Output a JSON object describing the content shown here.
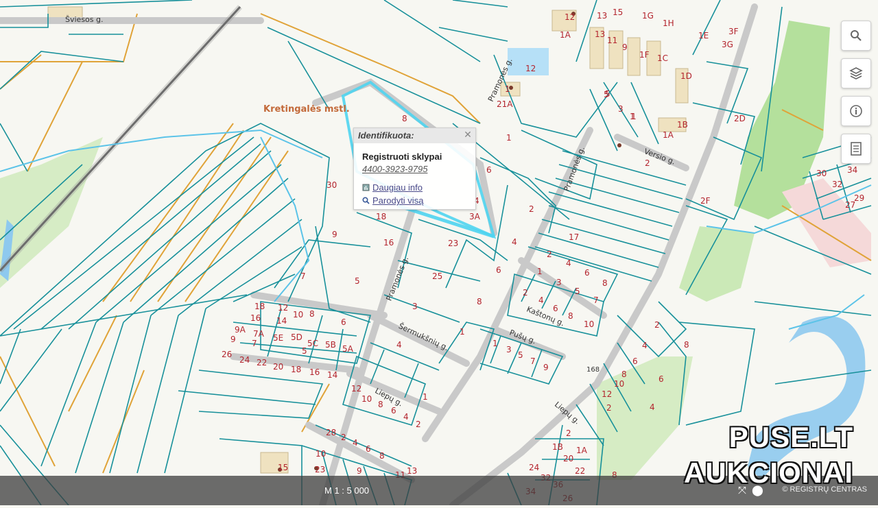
{
  "colors": {
    "parcel": "#17909a",
    "road": "#c9c9c9",
    "water": "#8ec9ee",
    "green": "#a5d98a",
    "orange": "#e0a338",
    "labels": "#b3242d",
    "highlight": "#4fd4f0"
  },
  "place_name": "Kretingalės mstl.",
  "streets": [
    "Šviesos g.",
    "Pramonės g.",
    "Pramonės g.",
    "Versio g.",
    "Pramonės g.",
    "Šermukšnių g.",
    "Kaštonų g.",
    "Pušų g.",
    "Liepų g.",
    "Liepų g."
  ],
  "road_number": "168",
  "parcel_labels": [
    "8",
    "30",
    "9",
    "18",
    "16",
    "7",
    "5",
    "23",
    "25",
    "3",
    "4",
    "3A",
    "6",
    "2",
    "4",
    "6",
    "8",
    "1",
    "17",
    "2",
    "4",
    "6",
    "8",
    "1",
    "3",
    "5",
    "7",
    "2",
    "4",
    "6",
    "8",
    "10",
    "1",
    "3",
    "5",
    "7",
    "9",
    "4",
    "2",
    "1",
    "12",
    "10",
    "8",
    "6",
    "4",
    "2",
    "1",
    "18",
    "12",
    "16",
    "14",
    "10",
    "8",
    "6",
    "9A",
    "7A",
    "5E",
    "5D",
    "5C",
    "5B",
    "5A",
    "9",
    "7",
    "5",
    "26",
    "24",
    "22",
    "20",
    "18",
    "16",
    "14",
    "12",
    "5",
    "1",
    "1A",
    "12",
    "21A",
    "1",
    "5",
    "3",
    "1",
    "1D",
    "1B",
    "1A",
    "1C",
    "1F",
    "9",
    "11",
    "13",
    "1H",
    "1G",
    "1E",
    "15",
    "13",
    "3G",
    "3F",
    "2D",
    "2F",
    "2",
    "30",
    "32",
    "34",
    "27",
    "29",
    "2",
    "4",
    "6",
    "8",
    "10",
    "12",
    "2",
    "4",
    "6",
    "8",
    "8",
    "2",
    "1A",
    "1B",
    "20",
    "22",
    "24",
    "32",
    "34",
    "36",
    "26",
    "28",
    "2",
    "4",
    "6",
    "8",
    "10",
    "9",
    "11",
    "13",
    "15",
    "23",
    "1"
  ],
  "popup": {
    "title": "Identifikuota:",
    "close_icon": "close-icon",
    "layer": "Registruoti sklypai",
    "parcel_id": "4400-3923-9795",
    "more_info": "Daugiau info",
    "show_all": "Parodyti visą"
  },
  "tools": [
    {
      "name": "search-icon",
      "symbol": "⚲"
    },
    {
      "name": "layers-icon",
      "symbol": "◈"
    },
    {
      "name": "info-icon",
      "symbol": "ⓘ"
    },
    {
      "name": "document-icon",
      "symbol": "▤"
    }
  ],
  "scale": "M 1 : 5 000",
  "watermark": {
    "line1": "PUSE.LT",
    "line2": "AUKCIONAI"
  },
  "footer": "© REGISTRŲ CENTRAS"
}
